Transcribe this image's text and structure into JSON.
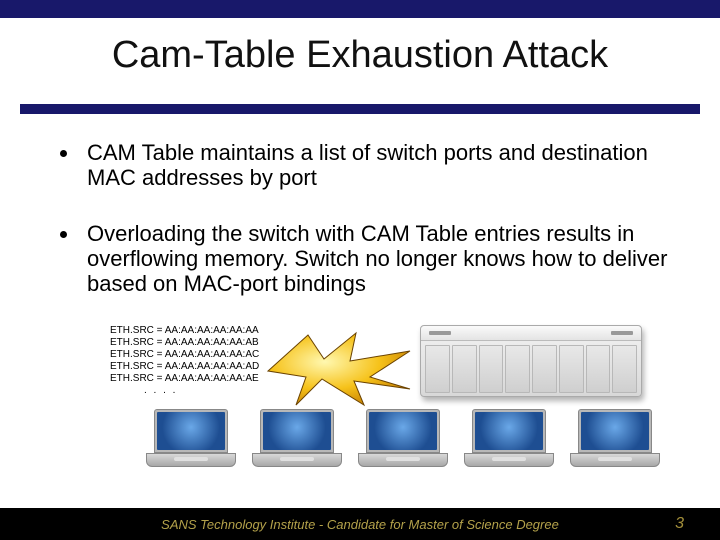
{
  "title": "Cam-Table Exhaustion Attack",
  "bullets": [
    "CAM Table maintains a list of switch ports and destination MAC addresses by port",
    "Overloading the switch with CAM Table entries results in overflowing memory. Switch no longer knows how to deliver based on MAC-port bindings"
  ],
  "eth_lines": [
    "ETH.SRC = AA:AA:AA:AA:AA:AA",
    "ETH.SRC = AA:AA:AA:AA:AA:AB",
    "ETH.SRC = AA:AA:AA:AA:AA:AC",
    "ETH.SRC = AA:AA:AA:AA:AA:AD",
    "ETH.SRC = AA:AA:AA:AA:AA:AE"
  ],
  "eth_ellipsis": ". . . .",
  "footer": {
    "text": "SANS Technology Institute - Candidate for Master of Science Degree",
    "page": "3"
  }
}
